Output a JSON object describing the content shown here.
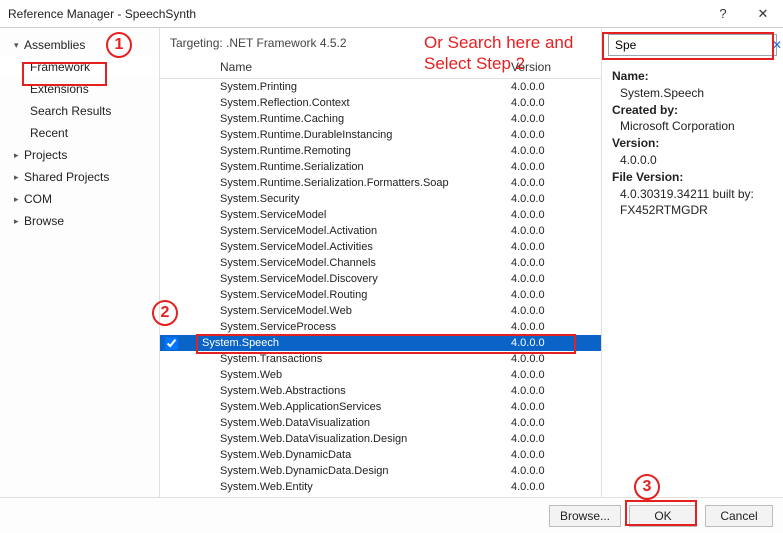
{
  "window": {
    "title": "Reference Manager - SpeechSynth",
    "help": "?",
    "close": "✕"
  },
  "sidebar": {
    "groups": [
      {
        "label": "Assemblies",
        "expanded": true,
        "children": [
          {
            "label": "Framework",
            "selected": true
          },
          {
            "label": "Extensions"
          },
          {
            "label": "Search Results"
          },
          {
            "label": "Recent"
          }
        ]
      },
      {
        "label": "Projects",
        "expanded": false
      },
      {
        "label": "Shared Projects",
        "expanded": false
      },
      {
        "label": "COM",
        "expanded": false
      },
      {
        "label": "Browse",
        "expanded": false
      }
    ]
  },
  "targeting": "Targeting: .NET Framework 4.5.2",
  "columns": {
    "name": "Name",
    "version": "Version"
  },
  "rows": [
    {
      "name": "System.Printing",
      "version": "4.0.0.0"
    },
    {
      "name": "System.Reflection.Context",
      "version": "4.0.0.0"
    },
    {
      "name": "System.Runtime.Caching",
      "version": "4.0.0.0"
    },
    {
      "name": "System.Runtime.DurableInstancing",
      "version": "4.0.0.0"
    },
    {
      "name": "System.Runtime.Remoting",
      "version": "4.0.0.0"
    },
    {
      "name": "System.Runtime.Serialization",
      "version": "4.0.0.0"
    },
    {
      "name": "System.Runtime.Serialization.Formatters.Soap",
      "version": "4.0.0.0"
    },
    {
      "name": "System.Security",
      "version": "4.0.0.0"
    },
    {
      "name": "System.ServiceModel",
      "version": "4.0.0.0"
    },
    {
      "name": "System.ServiceModel.Activation",
      "version": "4.0.0.0"
    },
    {
      "name": "System.ServiceModel.Activities",
      "version": "4.0.0.0"
    },
    {
      "name": "System.ServiceModel.Channels",
      "version": "4.0.0.0"
    },
    {
      "name": "System.ServiceModel.Discovery",
      "version": "4.0.0.0"
    },
    {
      "name": "System.ServiceModel.Routing",
      "version": "4.0.0.0"
    },
    {
      "name": "System.ServiceModel.Web",
      "version": "4.0.0.0"
    },
    {
      "name": "System.ServiceProcess",
      "version": "4.0.0.0"
    },
    {
      "name": "System.Speech",
      "version": "4.0.0.0",
      "checked": true,
      "selected": true
    },
    {
      "name": "System.Transactions",
      "version": "4.0.0.0"
    },
    {
      "name": "System.Web",
      "version": "4.0.0.0"
    },
    {
      "name": "System.Web.Abstractions",
      "version": "4.0.0.0"
    },
    {
      "name": "System.Web.ApplicationServices",
      "version": "4.0.0.0"
    },
    {
      "name": "System.Web.DataVisualization",
      "version": "4.0.0.0"
    },
    {
      "name": "System.Web.DataVisualization.Design",
      "version": "4.0.0.0"
    },
    {
      "name": "System.Web.DynamicData",
      "version": "4.0.0.0"
    },
    {
      "name": "System.Web.DynamicData.Design",
      "version": "4.0.0.0"
    },
    {
      "name": "System.Web.Entity",
      "version": "4.0.0.0"
    }
  ],
  "search": {
    "value": "Spe"
  },
  "details": {
    "name_label": "Name:",
    "name_value": "System.Speech",
    "created_label": "Created by:",
    "created_value": "Microsoft Corporation",
    "version_label": "Version:",
    "version_value": "4.0.0.0",
    "filever_label": "File Version:",
    "filever_value": "4.0.30319.34211 built by: FX452RTMGDR"
  },
  "footer": {
    "browse": "Browse...",
    "ok": "OK",
    "cancel": "Cancel"
  },
  "annotations": {
    "step1": "1",
    "step2": "2",
    "step3": "3",
    "hint_line1": "Or Search here and",
    "hint_line2": "Select Step 2"
  }
}
